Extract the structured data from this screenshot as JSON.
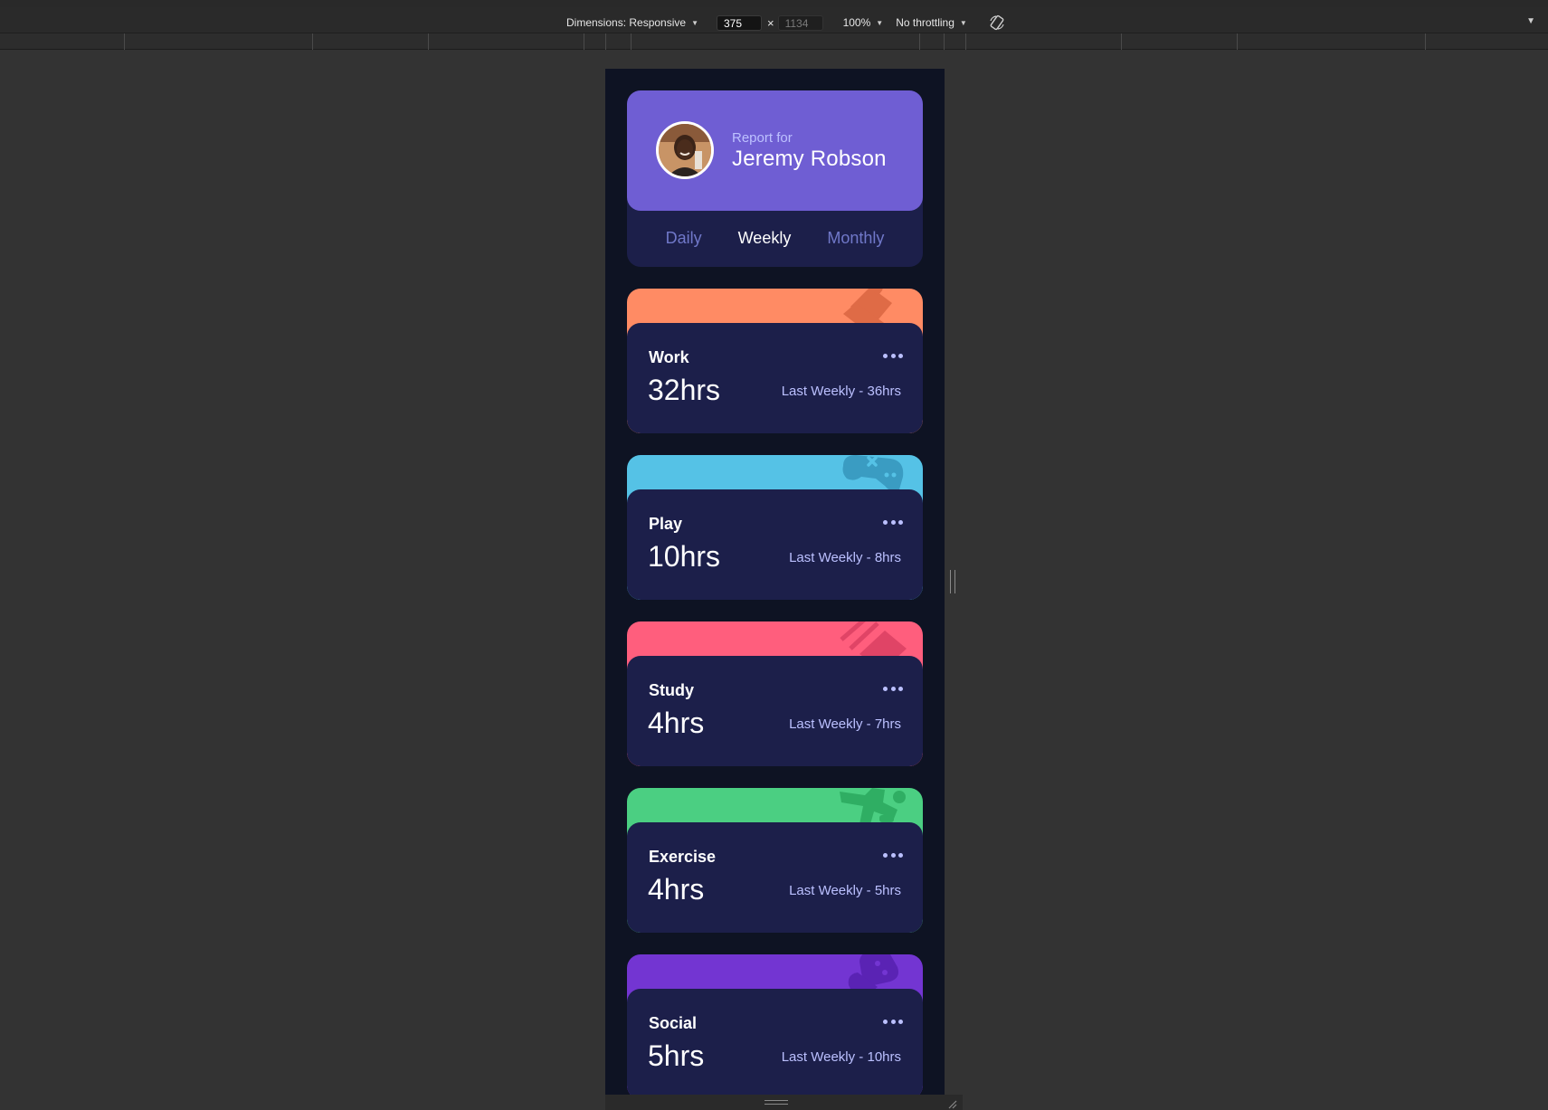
{
  "devtools": {
    "dimensions_label": "Dimensions: Responsive",
    "width": "375",
    "x_sep": "×",
    "height": "1134",
    "zoom": "100%",
    "throttling": "No throttling"
  },
  "profile": {
    "report_for": "Report for",
    "name": "Jeremy Robson"
  },
  "tabs": [
    {
      "label": "Daily",
      "active": false
    },
    {
      "label": "Weekly",
      "active": true
    },
    {
      "label": "Monthly",
      "active": false
    }
  ],
  "cards": [
    {
      "title": "Work",
      "hours": "32hrs",
      "previous": "Last Weekly - 36hrs",
      "color": "#ff8b64",
      "icon": "briefcase-icon"
    },
    {
      "title": "Play",
      "hours": "10hrs",
      "previous": "Last Weekly - 8hrs",
      "color": "#55c2e6",
      "icon": "gamepad-icon"
    },
    {
      "title": "Study",
      "hours": "4hrs",
      "previous": "Last Weekly - 7hrs",
      "color": "#ff5e7d",
      "icon": "book-icon"
    },
    {
      "title": "Exercise",
      "hours": "4hrs",
      "previous": "Last Weekly - 5hrs",
      "color": "#4bcf82",
      "icon": "runner-icon"
    },
    {
      "title": "Social",
      "hours": "5hrs",
      "previous": "Last Weekly - 10hrs",
      "color": "#7335d2",
      "icon": "speech-bubble-icon"
    }
  ],
  "colors": {
    "page_bg": "#0e1323",
    "card_bg": "#1c1f4a",
    "profile_bg": "#6f5ed3",
    "muted_text": "#bbc0ff",
    "tab_inactive": "#7078c9"
  }
}
